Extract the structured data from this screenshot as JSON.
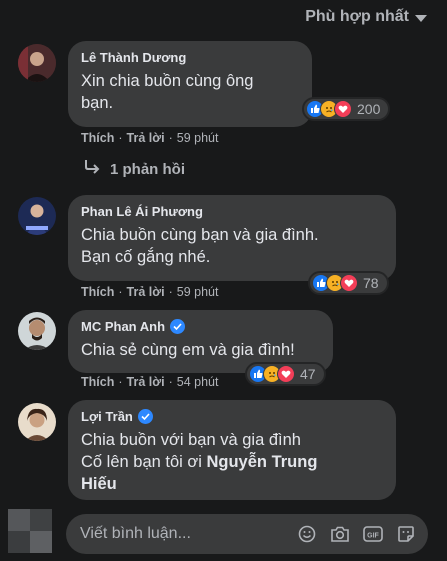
{
  "sort": {
    "label": "Phù hợp nhất"
  },
  "comments": [
    {
      "author": "Lê Thành Dương",
      "verified": false,
      "lines": [
        "Xin chia buồn cùng ông",
        "bạn."
      ],
      "like": "Thích",
      "reply": "Trả lời",
      "time": "59 phút",
      "reaction_count": "200",
      "reactions": [
        "like-icon",
        "sad-icon",
        "love-icon"
      ]
    },
    {
      "author": "Phan Lê Ái Phương",
      "verified": false,
      "lines": [
        "Chia buồn cùng bạn và gia đình.",
        "Bạn cố gắng nhé."
      ],
      "like": "Thích",
      "reply": "Trả lời",
      "time": "59 phút",
      "reaction_count": "78",
      "reactions": [
        "like-icon",
        "sad-icon",
        "love-icon"
      ]
    },
    {
      "author": "MC Phan Anh",
      "verified": true,
      "lines": [
        "Chia sẻ cùng em và gia đình!"
      ],
      "like": "Thích",
      "reply": "Trả lời",
      "time": "54 phút",
      "reaction_count": "47",
      "reactions": [
        "like-icon",
        "sad-icon",
        "love-icon"
      ]
    },
    {
      "author": "Lợi Trần",
      "verified": true,
      "lines": [
        "Chia buồn với bạn và gia đình",
        "Cố lên bạn tôi ơi "
      ],
      "mention_a": "Nguyễn Trung",
      "mention_b": "Hiếu"
    }
  ],
  "replies_link": "1 phản hồi",
  "composer": {
    "placeholder": "Viết bình luận...",
    "icons": [
      "emoji-icon",
      "camera-icon",
      "gif-icon",
      "sticker-icon"
    ]
  },
  "colors": {
    "background": "#18191a",
    "bubble": "#3a3b3c",
    "like": "#1877f2",
    "sad": "#f7b125",
    "love": "#f33e58",
    "verified": "#2d88ff"
  }
}
